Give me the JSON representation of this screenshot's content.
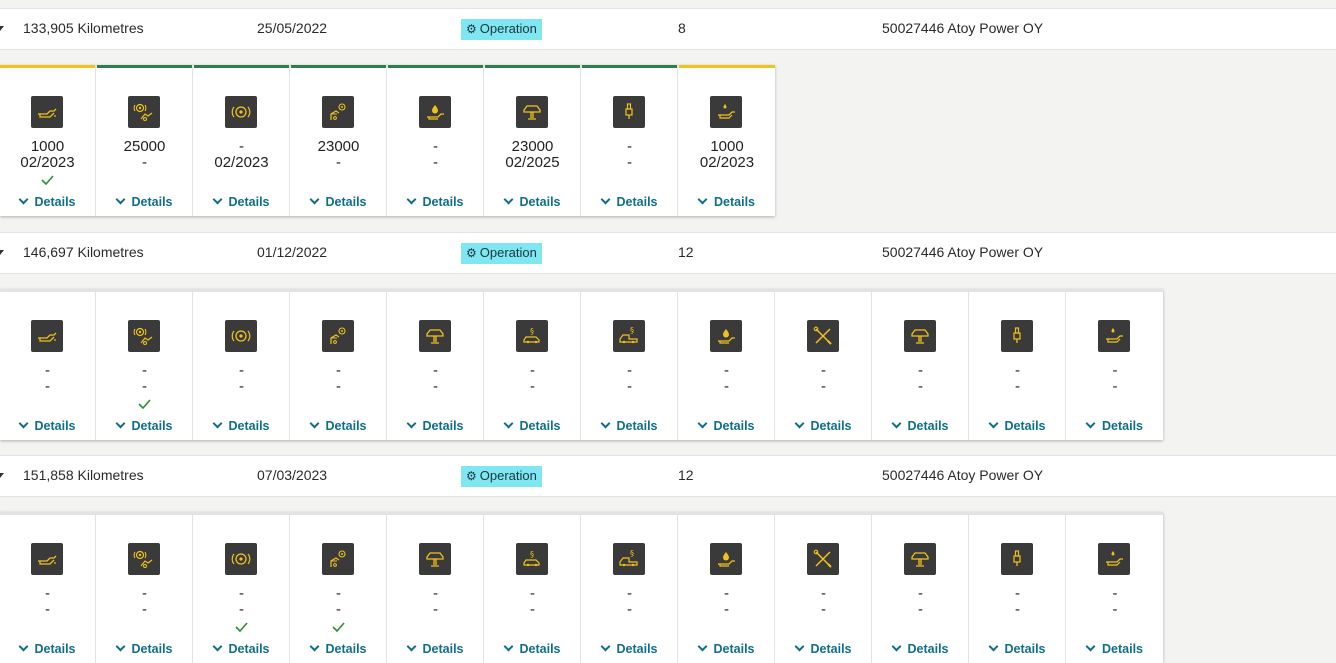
{
  "colors": {
    "accent_cyan": "#7fe6f2",
    "link_teal": "#0f6f8a",
    "status_green": "#2e7d4a",
    "status_yellow": "#f0c419",
    "status_gray": "#e3e3e3",
    "icon_fill": "#3a3a3a",
    "icon_stroke": "#f1c21b",
    "check_green": "#2e8b3a"
  },
  "common": {
    "details_label": "Details",
    "type_label": "Operation",
    "dealer": "50027446 Atoy Power OY"
  },
  "records": [
    {
      "kilometres": "133,905 Kilometres",
      "date": "25/05/2022",
      "type": "Operation",
      "count": "8",
      "dealer": "50027446 Atoy Power OY",
      "items": [
        {
          "icon": "oil-can-icon",
          "value": "1000",
          "date": "02/2023",
          "checked": true,
          "status": "yellow"
        },
        {
          "icon": "brake-service-icon",
          "value": "25000",
          "date": "-",
          "checked": false,
          "status": "green"
        },
        {
          "icon": "brake-disc-icon",
          "value": "-",
          "date": "02/2023",
          "checked": false,
          "status": "green"
        },
        {
          "icon": "brake-fluid-icon",
          "value": "23000",
          "date": "-",
          "checked": false,
          "status": "green"
        },
        {
          "icon": "oil-drop-icon",
          "value": "-",
          "date": "-",
          "checked": false,
          "status": "green"
        },
        {
          "icon": "car-lift-icon",
          "value": "23000",
          "date": "02/2025",
          "checked": false,
          "status": "green"
        },
        {
          "icon": "spark-plug-icon",
          "value": "-",
          "date": "-",
          "checked": false,
          "status": "green"
        },
        {
          "icon": "oil-level-icon",
          "value": "1000",
          "date": "02/2023",
          "checked": false,
          "status": "yellow"
        }
      ]
    },
    {
      "kilometres": "146,697 Kilometres",
      "date": "01/12/2022",
      "type": "Operation",
      "count": "12",
      "dealer": "50027446 Atoy Power OY",
      "items": [
        {
          "icon": "oil-can-icon",
          "value": "-",
          "date": "-",
          "checked": false,
          "status": "gray"
        },
        {
          "icon": "brake-service-icon",
          "value": "-",
          "date": "-",
          "checked": true,
          "status": "gray"
        },
        {
          "icon": "brake-disc-icon",
          "value": "-",
          "date": "-",
          "checked": false,
          "status": "gray"
        },
        {
          "icon": "brake-fluid-icon",
          "value": "-",
          "date": "-",
          "checked": false,
          "status": "gray"
        },
        {
          "icon": "car-lift-icon",
          "value": "-",
          "date": "-",
          "checked": false,
          "status": "gray"
        },
        {
          "icon": "inspection-car-icon",
          "value": "-",
          "date": "-",
          "checked": false,
          "status": "gray"
        },
        {
          "icon": "inspection-pickup-icon",
          "value": "-",
          "date": "-",
          "checked": false,
          "status": "gray"
        },
        {
          "icon": "oil-drop-icon",
          "value": "-",
          "date": "-",
          "checked": false,
          "status": "gray"
        },
        {
          "icon": "tools-icon",
          "value": "-",
          "date": "-",
          "checked": false,
          "status": "gray"
        },
        {
          "icon": "car-lift-icon",
          "value": "-",
          "date": "-",
          "checked": false,
          "status": "gray"
        },
        {
          "icon": "spark-plug-icon",
          "value": "-",
          "date": "-",
          "checked": false,
          "status": "gray"
        },
        {
          "icon": "oil-level-icon",
          "value": "-",
          "date": "-",
          "checked": false,
          "status": "gray"
        }
      ]
    },
    {
      "kilometres": "151,858 Kilometres",
      "date": "07/03/2023",
      "type": "Operation",
      "count": "12",
      "dealer": "50027446 Atoy Power OY",
      "items": [
        {
          "icon": "oil-can-icon",
          "value": "-",
          "date": "-",
          "checked": false,
          "status": "gray"
        },
        {
          "icon": "brake-service-icon",
          "value": "-",
          "date": "-",
          "checked": false,
          "status": "gray"
        },
        {
          "icon": "brake-disc-icon",
          "value": "-",
          "date": "-",
          "checked": true,
          "status": "gray"
        },
        {
          "icon": "brake-fluid-icon",
          "value": "-",
          "date": "-",
          "checked": true,
          "status": "gray"
        },
        {
          "icon": "car-lift-icon",
          "value": "-",
          "date": "-",
          "checked": false,
          "status": "gray"
        },
        {
          "icon": "inspection-car-icon",
          "value": "-",
          "date": "-",
          "checked": false,
          "status": "gray"
        },
        {
          "icon": "inspection-pickup-icon",
          "value": "-",
          "date": "-",
          "checked": false,
          "status": "gray"
        },
        {
          "icon": "oil-drop-icon",
          "value": "-",
          "date": "-",
          "checked": false,
          "status": "gray"
        },
        {
          "icon": "tools-icon",
          "value": "-",
          "date": "-",
          "checked": false,
          "status": "gray"
        },
        {
          "icon": "car-lift-icon",
          "value": "-",
          "date": "-",
          "checked": false,
          "status": "gray"
        },
        {
          "icon": "spark-plug-icon",
          "value": "-",
          "date": "-",
          "checked": false,
          "status": "gray"
        },
        {
          "icon": "oil-level-icon",
          "value": "-",
          "date": "-",
          "checked": false,
          "status": "gray"
        }
      ]
    }
  ]
}
